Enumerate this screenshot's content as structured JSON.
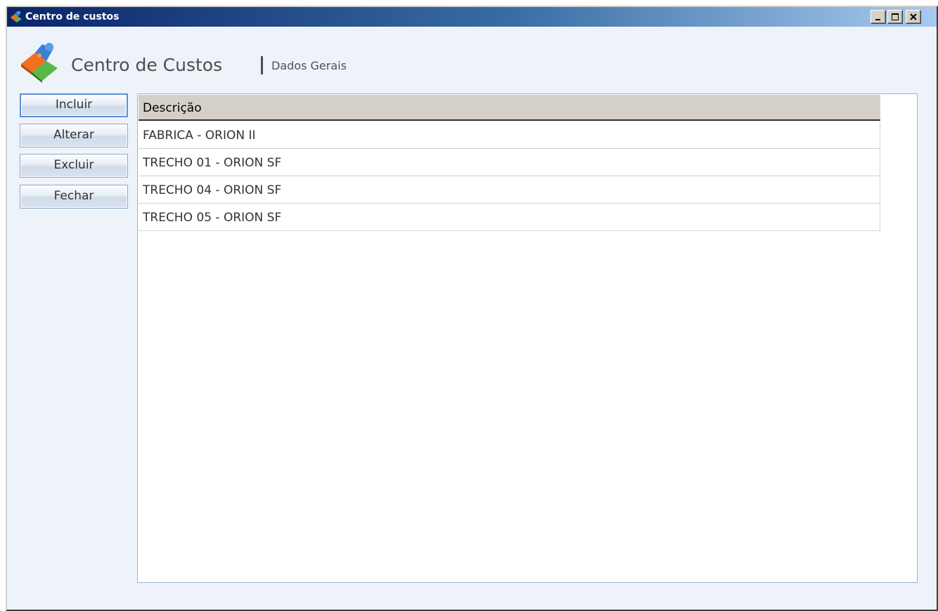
{
  "window": {
    "title": "Centro de custos",
    "controls": {
      "minimize_icon": "minimize-icon",
      "maximize_icon": "maximize-icon",
      "close_icon": "close-icon"
    }
  },
  "header": {
    "icon": "puzzle-pieces-icon",
    "title": "Centro de Custos",
    "separator": "|",
    "subtitle": "Dados Gerais"
  },
  "actions": {
    "include": "Incluir",
    "edit": "Alterar",
    "delete": "Excluir",
    "close": "Fechar"
  },
  "grid": {
    "columns": [
      "Descrição"
    ],
    "rows": [
      "FABRICA - ORION II",
      "TRECHO 01 - ORION SF",
      "TRECHO 04 - ORION SF",
      "TRECHO 05 - ORION SF"
    ]
  },
  "colors": {
    "title_bar_start": "#0a246a",
    "title_bar_end": "#a6caf0",
    "window_background": "#eef3fa",
    "grid_header": "#d4d0c8",
    "active_button_border": "#5b8ed6"
  }
}
